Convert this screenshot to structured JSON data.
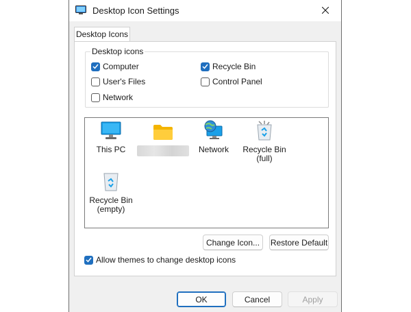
{
  "window": {
    "title": "Desktop Icon Settings",
    "close_icon": "close-icon",
    "app_icon": "display-settings-icon"
  },
  "tabs": [
    {
      "label": "Desktop Icons",
      "selected": true
    }
  ],
  "desktop_icons_group": {
    "label": "Desktop icons",
    "checkboxes": [
      {
        "label": "Computer",
        "checked": true
      },
      {
        "label": "Recycle Bin",
        "checked": true
      },
      {
        "label": "User's Files",
        "checked": false
      },
      {
        "label": "Control Panel",
        "checked": false
      },
      {
        "label": "Network",
        "checked": false
      }
    ]
  },
  "icon_list": [
    {
      "label": "This PC",
      "icon": "monitor-icon"
    },
    {
      "label": "",
      "icon": "folder-icon",
      "label_obscured": true
    },
    {
      "label": "Network",
      "icon": "network-globe-icon"
    },
    {
      "label": "Recycle Bin (full)",
      "line1": "Recycle Bin",
      "line2": "(full)",
      "icon": "recycle-bin-full-icon"
    },
    {
      "label": "Recycle Bin (empty)",
      "line1": "Recycle Bin",
      "line2": "(empty)",
      "icon": "recycle-bin-empty-icon"
    }
  ],
  "buttons": {
    "change_icon": "Change Icon...",
    "restore_default": "Restore Default",
    "ok": "OK",
    "cancel": "Cancel",
    "apply": "Apply"
  },
  "allow_themes": {
    "label": "Allow themes to change desktop icons",
    "checked": true
  },
  "colors": {
    "accent": "#1f6fbf",
    "dialog_bg": "#f0f0f0"
  }
}
